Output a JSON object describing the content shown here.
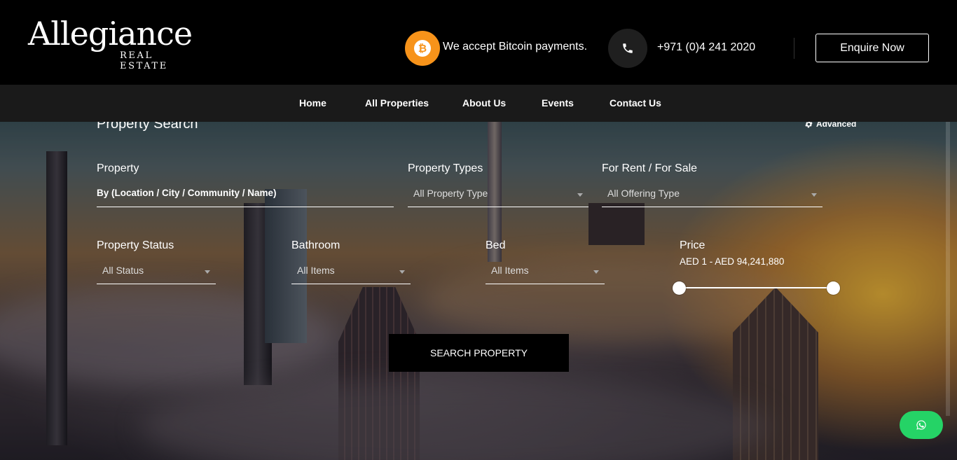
{
  "brand": {
    "logo_main": "Allegiance",
    "logo_sub": "REAL ESTATE"
  },
  "header": {
    "bitcoin_icon": "bitcoin-icon",
    "bitcoin_symbol": "₿",
    "bitcoin_text": "We accept Bitcoin payments.",
    "phone_icon": "phone-icon",
    "phone_number": "+971 (0)4 241 2020",
    "enquire_label": "Enquire Now"
  },
  "nav": {
    "items": [
      {
        "label": "Home"
      },
      {
        "label": "All Properties"
      },
      {
        "label": "About Us"
      },
      {
        "label": "Events"
      },
      {
        "label": "Contact Us"
      }
    ]
  },
  "search": {
    "title": "Property Search",
    "advanced_label": "Advanced",
    "property": {
      "label": "Property",
      "value": "By (Location / City / Community / Name)"
    },
    "property_types": {
      "label": "Property Types",
      "value": "All Property Type"
    },
    "offering": {
      "label": "For Rent / For Sale",
      "value": "All Offering Type"
    },
    "status": {
      "label": "Property Status",
      "value": "All Status"
    },
    "bathroom": {
      "label": "Bathroom",
      "value": "All Items"
    },
    "bed": {
      "label": "Bed",
      "value": "All Items"
    },
    "price": {
      "label": "Price",
      "value": "AED 1 - AED 94,241,880",
      "min_fraction": 0,
      "max_fraction": 1
    },
    "submit_label": "SEARCH PROPERTY"
  },
  "colors": {
    "bitcoin": "#f7931a",
    "whatsapp": "#25d366",
    "header_bg": "#000000",
    "nav_bg": "#1a1a1a"
  },
  "floating": {
    "whatsapp_icon": "whatsapp-icon"
  }
}
